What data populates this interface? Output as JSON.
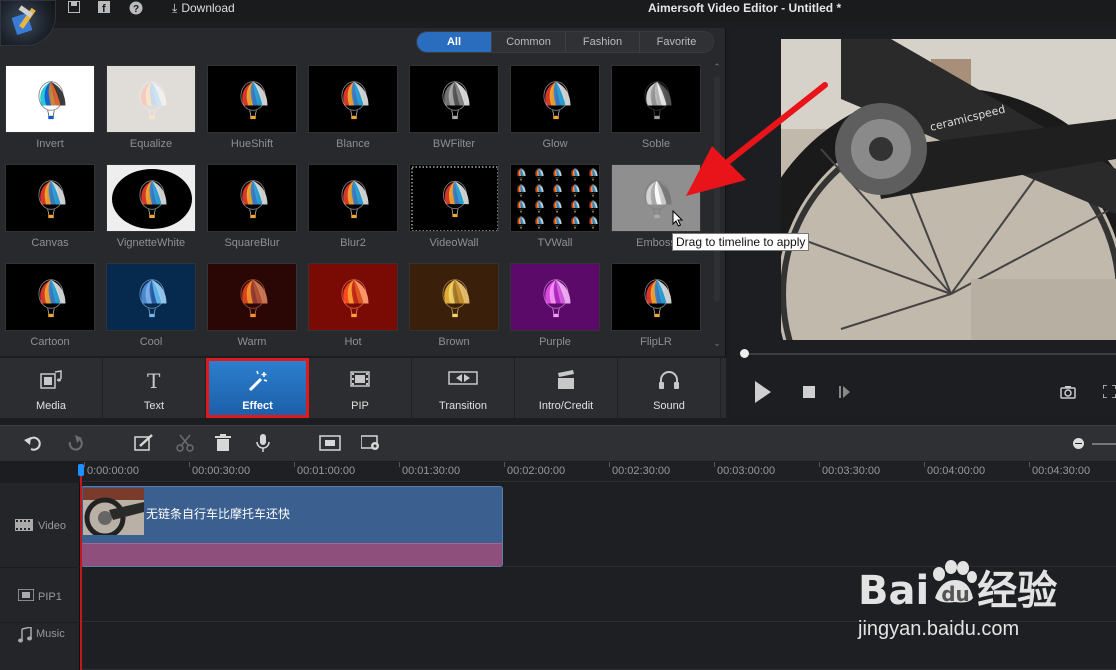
{
  "window": {
    "title": "Aimersoft Video Editor - Untitled *",
    "download_label": "Download",
    "toolbar_icons": [
      "save-icon",
      "facebook-icon",
      "help-icon",
      "download-icon"
    ]
  },
  "effects": {
    "filter_tabs": [
      {
        "label": "All",
        "active": true
      },
      {
        "label": "Common",
        "active": false
      },
      {
        "label": "Fashion",
        "active": false
      },
      {
        "label": "Favorite",
        "active": false
      }
    ],
    "items": [
      {
        "label": "Invert"
      },
      {
        "label": "Equalize"
      },
      {
        "label": "HueShift"
      },
      {
        "label": "Blance"
      },
      {
        "label": "BWFilter"
      },
      {
        "label": "Glow"
      },
      {
        "label": "Soble"
      },
      {
        "label": "Canvas"
      },
      {
        "label": "VignetteWhite"
      },
      {
        "label": "SquareBlur"
      },
      {
        "label": "Blur2"
      },
      {
        "label": "VideoWall"
      },
      {
        "label": "TVWall"
      },
      {
        "label": "Emboss"
      },
      {
        "label": "Cartoon"
      },
      {
        "label": "Cool"
      },
      {
        "label": "Warm"
      },
      {
        "label": "Hot"
      },
      {
        "label": "Brown"
      },
      {
        "label": "Purple"
      },
      {
        "label": "FlipLR"
      }
    ],
    "tooltip": "Drag to timeline to apply"
  },
  "tool_tabs": [
    {
      "label": "Media",
      "icon": "film-music-icon",
      "active": false
    },
    {
      "label": "Text",
      "icon": "text-icon",
      "active": false
    },
    {
      "label": "Effect",
      "icon": "magic-wand-icon",
      "active": true
    },
    {
      "label": "PIP",
      "icon": "film-strip-icon",
      "active": false
    },
    {
      "label": "Transition",
      "icon": "transition-icon",
      "active": false
    },
    {
      "label": "Intro/Credit",
      "icon": "clapperboard-icon",
      "active": false
    },
    {
      "label": "Sound",
      "icon": "headphones-icon",
      "active": false
    }
  ],
  "timeline": {
    "ruler": [
      "0:00:00:00",
      "00:00:30:00",
      "00:01:00:00",
      "00:01:30:00",
      "00:02:00:00",
      "00:02:30:00",
      "00:03:00:00",
      "00:03:30:00",
      "00:04:00:00",
      "00:04:30:00"
    ],
    "tracks": [
      {
        "label": "Video",
        "icon": "film-icon"
      },
      {
        "label": "PIP1",
        "icon": "film-strip-icon"
      },
      {
        "label": "Music",
        "icon": "music-note-icon"
      }
    ],
    "clip_title": "无链条自行车比摩托车还快"
  },
  "watermark": {
    "brand_left": "Bai",
    "brand_paw": "du",
    "brand_right": "经验",
    "url": "jingyan.baidu.com"
  }
}
